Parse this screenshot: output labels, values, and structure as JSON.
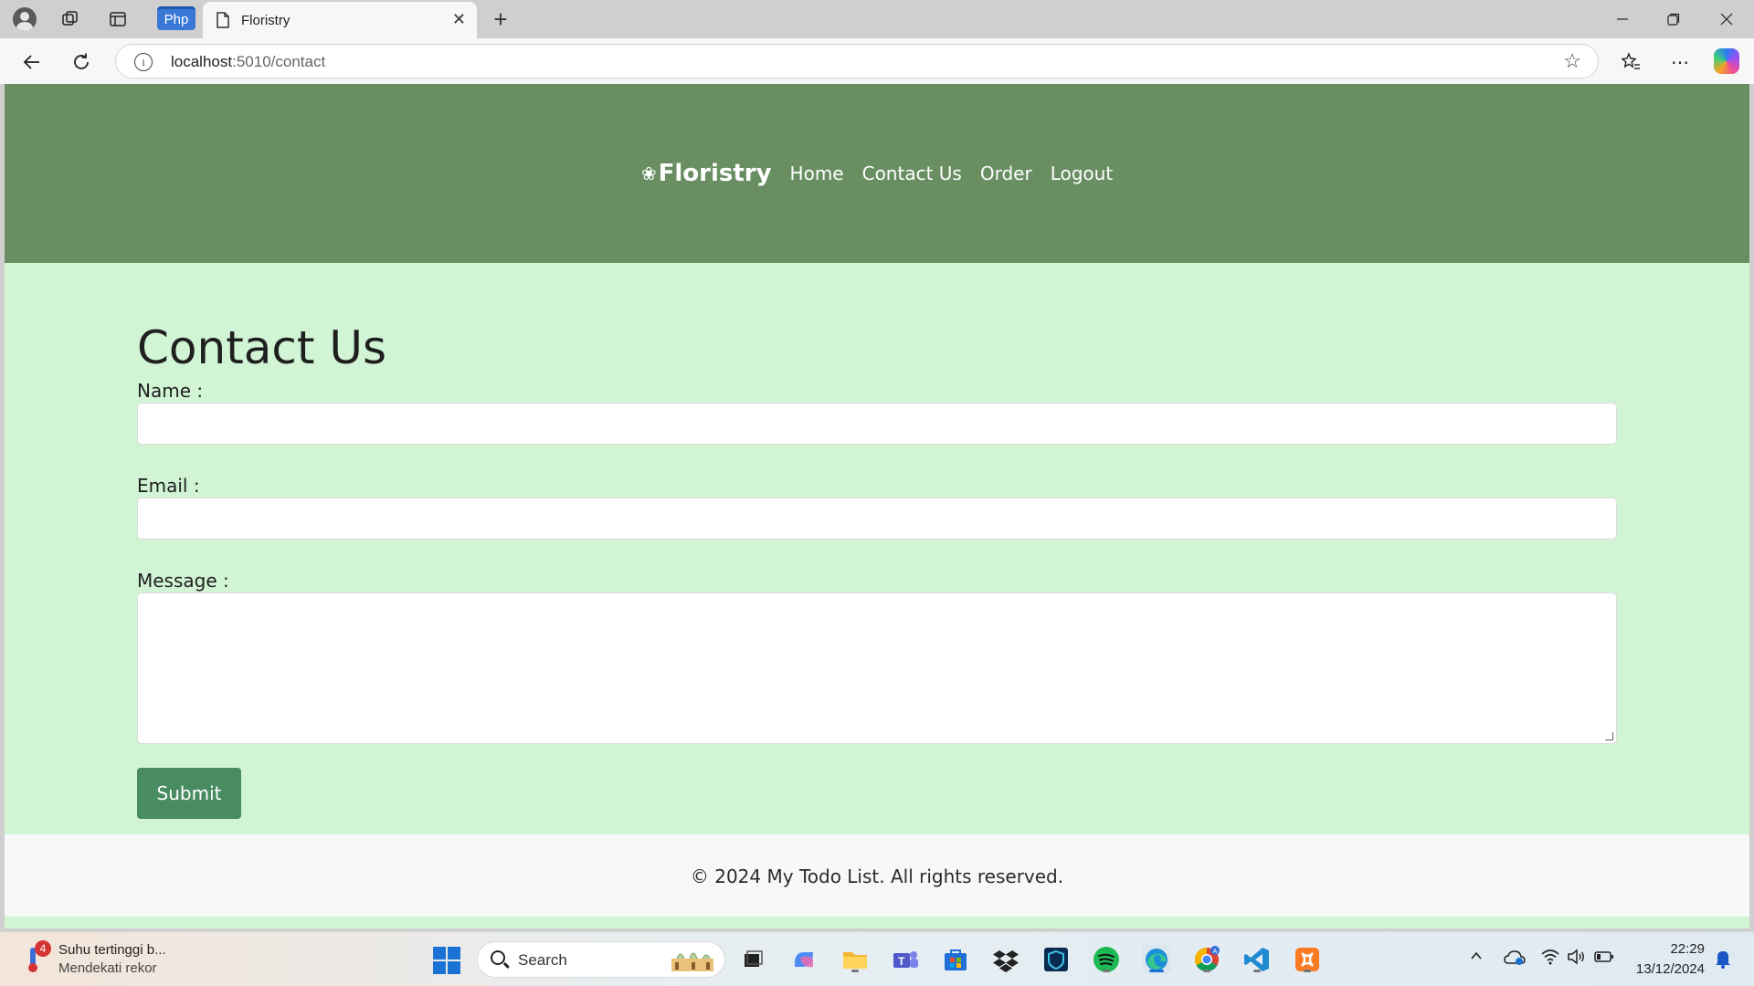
{
  "browser": {
    "pinned_tab_label": "Php",
    "tab_title": "Floristry",
    "url_host": "localhost",
    "url_path": ":5010/contact"
  },
  "site": {
    "brand": "Floristry",
    "nav": [
      "Home",
      "Contact Us",
      "Order",
      "Logout"
    ],
    "brand_color": "#688e62",
    "background_color": "#d0f4d4",
    "button_color": "#4a8c62"
  },
  "form": {
    "title": "Contact Us",
    "name_label": "Name :",
    "name_value": "",
    "email_label": "Email :",
    "email_value": "",
    "message_label": "Message :",
    "message_value": "",
    "submit_label": "Submit"
  },
  "footer": {
    "text": "© 2024 My Todo List. All rights reserved."
  },
  "taskbar": {
    "weather_badge": "4",
    "weather_line1": "Suhu tertinggi b...",
    "weather_line2": "Mendekati rekor",
    "search_placeholder": "Search",
    "time": "22:29",
    "date": "13/12/2024"
  }
}
